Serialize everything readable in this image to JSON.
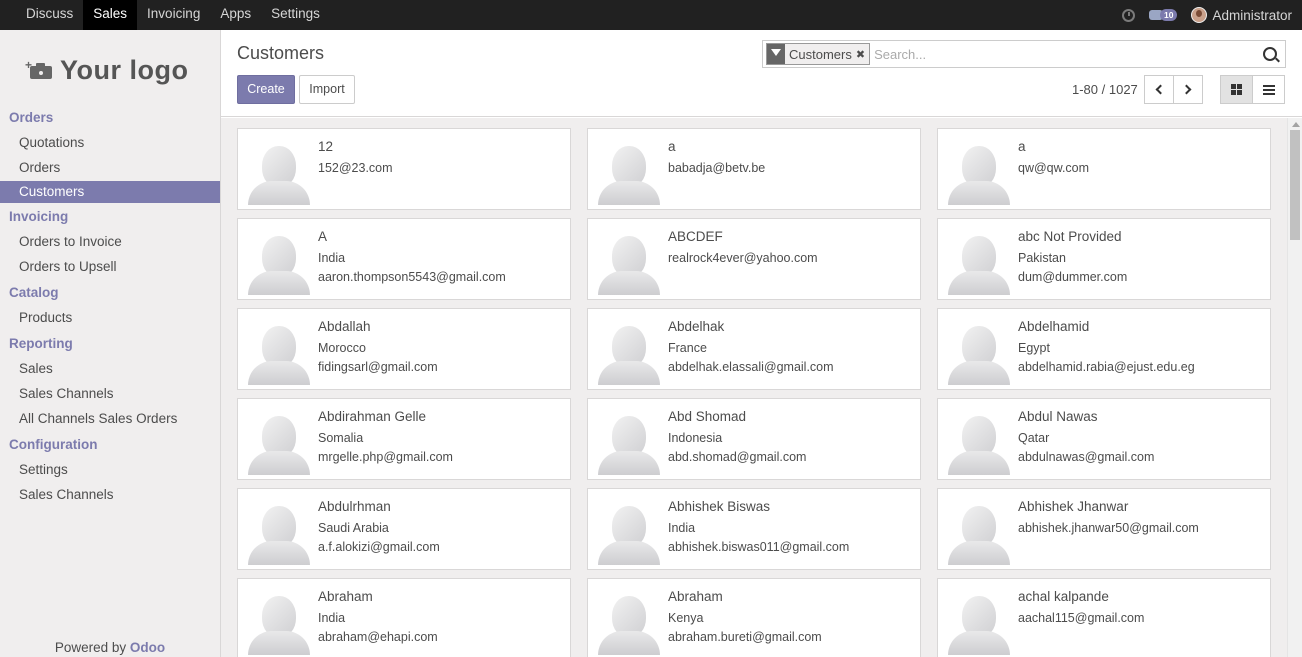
{
  "topbar": {
    "menu": [
      "Discuss",
      "Sales",
      "Invoicing",
      "Apps",
      "Settings"
    ],
    "active_index": 1,
    "message_count": "10",
    "user_name": "Administrator"
  },
  "sidebar": {
    "logo_text": "Your logo",
    "sections": [
      {
        "title": "Orders",
        "items": [
          "Quotations",
          "Orders",
          "Customers"
        ]
      },
      {
        "title": "Invoicing",
        "items": [
          "Orders to Invoice",
          "Orders to Upsell"
        ]
      },
      {
        "title": "Catalog",
        "items": [
          "Products"
        ]
      },
      {
        "title": "Reporting",
        "items": [
          "Sales",
          "Sales Channels",
          "All Channels Sales Orders"
        ]
      },
      {
        "title": "Configuration",
        "items": [
          "Settings",
          "Sales Channels"
        ]
      }
    ],
    "active_item": "Customers",
    "powered_prefix": "Powered by ",
    "powered_brand": "Odoo"
  },
  "control_panel": {
    "title": "Customers",
    "create_label": "Create",
    "import_label": "Import",
    "facet_label": "Customers",
    "search_placeholder": "Search...",
    "pager": "1-80 / 1027"
  },
  "customers": [
    {
      "name": "12",
      "line1": "152@23.com",
      "line2": ""
    },
    {
      "name": "a",
      "line1": "babadja@betv.be",
      "line2": ""
    },
    {
      "name": "a",
      "line1": "qw@qw.com",
      "line2": ""
    },
    {
      "name": "A",
      "line1": "India",
      "line2": "aaron.thompson5543@gmail.com"
    },
    {
      "name": "ABCDEF",
      "line1": "realrock4ever@yahoo.com",
      "line2": ""
    },
    {
      "name": "abc Not Provided",
      "line1": "Pakistan",
      "line2": "dum@dummer.com"
    },
    {
      "name": "Abdallah",
      "line1": "Morocco",
      "line2": "fidingsarl@gmail.com"
    },
    {
      "name": "Abdelhak",
      "line1": "France",
      "line2": "abdelhak.elassali@gmail.com"
    },
    {
      "name": "Abdelhamid",
      "line1": "Egypt",
      "line2": "abdelhamid.rabia@ejust.edu.eg"
    },
    {
      "name": "Abdirahman Gelle",
      "line1": "Somalia",
      "line2": "mrgelle.php@gmail.com"
    },
    {
      "name": "Abd Shomad",
      "line1": "Indonesia",
      "line2": "abd.shomad@gmail.com"
    },
    {
      "name": "Abdul Nawas",
      "line1": "Qatar",
      "line2": "abdulnawas@gmail.com"
    },
    {
      "name": "Abdulrhman",
      "line1": "Saudi Arabia",
      "line2": "a.f.alokizi@gmail.com"
    },
    {
      "name": "Abhishek Biswas",
      "line1": "India",
      "line2": "abhishek.biswas011@gmail.com"
    },
    {
      "name": "Abhishek Jhanwar",
      "line1": "abhishek.jhanwar50@gmail.com",
      "line2": ""
    },
    {
      "name": "Abraham",
      "line1": "India",
      "line2": "abraham@ehapi.com"
    },
    {
      "name": "Abraham",
      "line1": "Kenya",
      "line2": "abraham.bureti@gmail.com"
    },
    {
      "name": "achal kalpande",
      "line1": "aachal115@gmail.com",
      "line2": ""
    }
  ],
  "colors": {
    "brand": "#7c7bad",
    "topbar": "#212121",
    "sidebar_bg": "#f0eeee"
  }
}
